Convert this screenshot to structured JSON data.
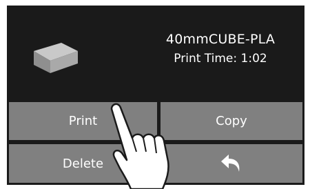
{
  "file": {
    "name": "40mmCUBE-PLA",
    "print_time": "Print Time: 1:02"
  },
  "buttons": {
    "print": "Print",
    "copy": "Copy",
    "delete": "Delete",
    "back_icon": "back-arrow-icon"
  },
  "colors": {
    "screen_bg": "#1a1a1a",
    "button_bg": "#808080",
    "text": "#ffffff"
  }
}
